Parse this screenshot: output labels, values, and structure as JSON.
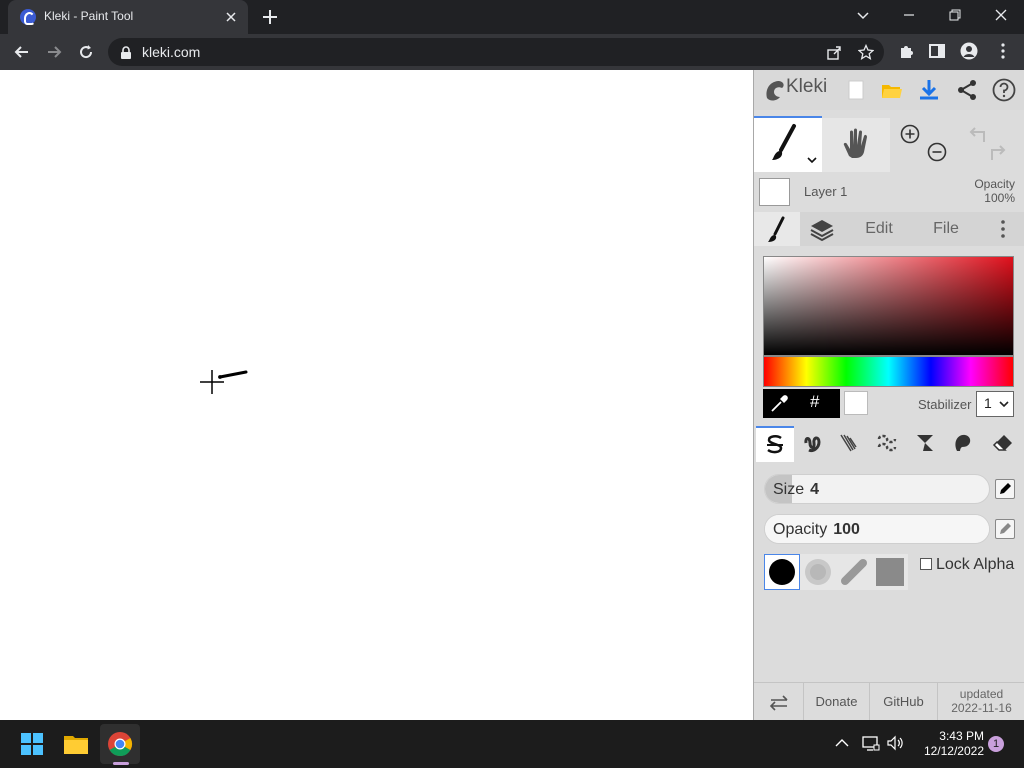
{
  "browser": {
    "tab_title": "Kleki - Paint Tool",
    "url": "kleki.com",
    "icons": {
      "favicon": "kleki-favicon-icon",
      "close_tab": "close-icon",
      "new_tab": "plus-icon",
      "minimize": "minimize-icon",
      "maximize": "restore-icon",
      "close_window": "close-icon",
      "tab_search": "chevron-down-icon",
      "back": "arrow-left-icon",
      "forward": "arrow-right-icon",
      "reload": "reload-icon",
      "lock": "lock-icon",
      "share": "share-icon",
      "bookmark": "star-icon",
      "extensions": "puzzle-icon",
      "side_panel": "side-panel-icon",
      "profile": "profile-icon",
      "menu": "kebab-menu-icon"
    }
  },
  "app": {
    "logo_text": "Kleki",
    "top_icons": [
      "new-image-icon",
      "open-folder-icon",
      "download-icon",
      "share-icon",
      "help-icon"
    ],
    "tools": [
      "brush-icon",
      "hand-icon",
      "zoom-in-icon",
      "zoom-out-icon",
      "undo-icon",
      "redo-icon"
    ],
    "layer": {
      "name": "Layer 1",
      "opacity_label": "Opacity",
      "opacity_value": "100%"
    },
    "tabs": {
      "edit": "Edit",
      "file": "File"
    },
    "color_picker": {
      "hue_color": "#e0101c",
      "hex_label": "#",
      "secondary_color": "#ffffff"
    },
    "stabilizer": {
      "label": "Stabilizer",
      "value": "1"
    },
    "brush_types": [
      "pen-brush-icon",
      "blend-brush-icon",
      "sketchy-brush-icon",
      "pixel-brush-icon",
      "chemy-brush-icon",
      "smudge-brush-icon",
      "eraser-icon"
    ],
    "size": {
      "label": "Size",
      "value": "4",
      "fill_fraction": 0.12
    },
    "opacity": {
      "label": "Opacity",
      "value": "100",
      "fill_fraction": 1.0
    },
    "brush_tips": [
      "circle-tip-icon",
      "soft-circle-tip-icon",
      "chalk-tip-icon",
      "square-tip-icon"
    ],
    "lock_alpha_label": "Lock Alpha",
    "footer": {
      "donate": "Donate",
      "github": "GitHub",
      "updated_label": "updated",
      "updated_date": "2022-11-16"
    }
  },
  "taskbar": {
    "apps": [
      "windows-start-icon",
      "file-explorer-icon",
      "chrome-icon"
    ],
    "time": "3:43 PM",
    "date": "12/12/2022",
    "notification_count": "1"
  }
}
